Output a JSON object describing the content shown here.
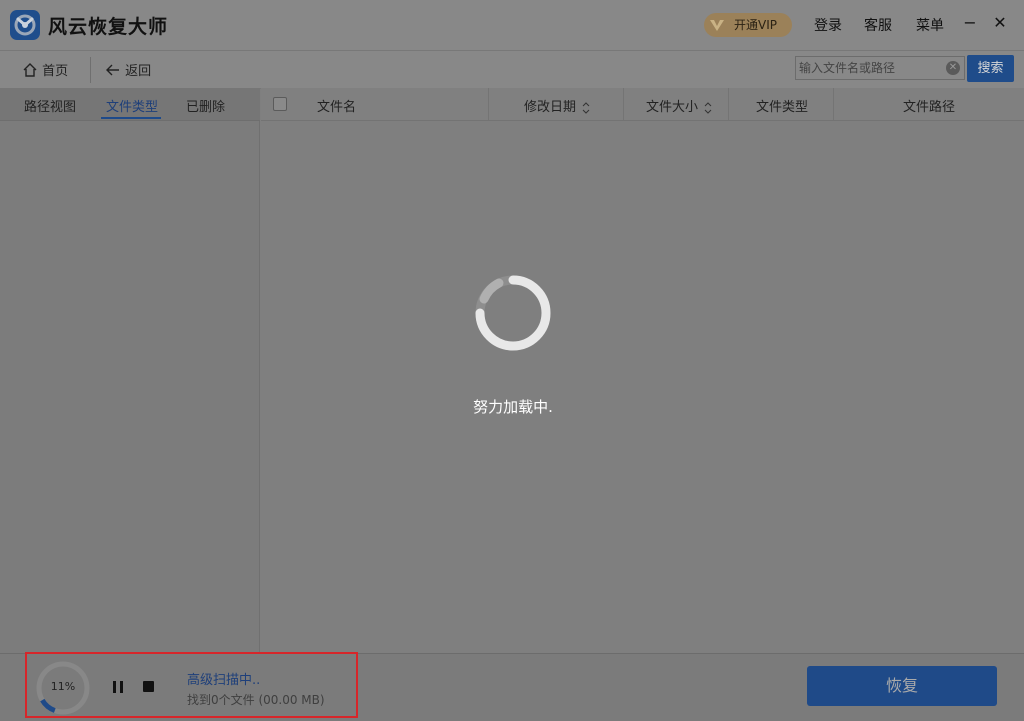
{
  "app": {
    "title": "风云恢复大师",
    "logo": "app-logo-icon"
  },
  "titlebar": {
    "vip_label": "开通VIP",
    "login_label": "登录",
    "service_label": "客服",
    "menu_label": "菜单",
    "minimize_glyph": "−",
    "close_glyph": "✕"
  },
  "toolbar": {
    "home_label": "首页",
    "back_label": "返回",
    "search_placeholder": "输入文件名或路径",
    "search_button": "搜索"
  },
  "left_tabs": [
    {
      "label": "路径视图",
      "active": false
    },
    {
      "label": "文件类型",
      "active": true
    },
    {
      "label": "已删除",
      "active": false
    }
  ],
  "table": {
    "columns": [
      "文件名",
      "修改日期",
      "文件大小",
      "文件类型",
      "文件路径"
    ],
    "rows": []
  },
  "loading": {
    "text": "努力加载中."
  },
  "scan": {
    "progress_percent": 11,
    "progress_label": "11%",
    "status": "高级扫描中..",
    "found": "找到0个文件 (00.00 MB)"
  },
  "actions": {
    "recover_label": "恢复"
  },
  "colors": {
    "accent": "#1f4a88",
    "highlight": "#d7262a",
    "vip": "#9b8159"
  }
}
